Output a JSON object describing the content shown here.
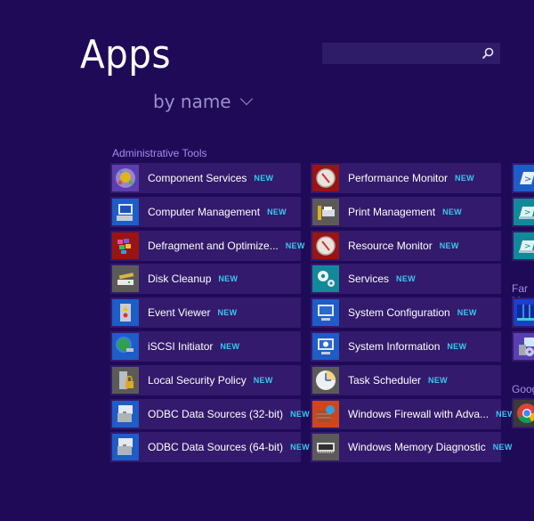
{
  "header": {
    "title": "Apps",
    "sort_label": "by name",
    "search": {
      "value": "",
      "placeholder": ""
    }
  },
  "colors": {
    "background": "#1e0a57",
    "tile": "#331a6c",
    "badge": "#39c8f0",
    "group_label": "#a58ce8"
  },
  "groups": [
    {
      "label": "Administrative Tools",
      "columns": [
        [
          {
            "label": "Component Services",
            "badge": "NEW",
            "icon": "component-services-icon",
            "icon_bg": "#5b3fb0"
          },
          {
            "label": "Computer Management",
            "badge": "NEW",
            "icon": "computer-management-icon",
            "icon_bg": "#1e5cc8"
          },
          {
            "label": "Defragment and Optimize...",
            "badge": "NEW",
            "icon": "defragment-icon",
            "icon_bg": "#9b1414"
          },
          {
            "label": "Disk Cleanup",
            "badge": "NEW",
            "icon": "disk-cleanup-icon",
            "icon_bg": "#5c5a58"
          },
          {
            "label": "Event Viewer",
            "badge": "NEW",
            "icon": "event-viewer-icon",
            "icon_bg": "#1e5cc8"
          },
          {
            "label": "iSCSI Initiator",
            "badge": "NEW",
            "icon": "iscsi-initiator-icon",
            "icon_bg": "#1e5cc8"
          },
          {
            "label": "Local Security Policy",
            "badge": "NEW",
            "icon": "local-security-policy-icon",
            "icon_bg": "#5c5a58"
          },
          {
            "label": "ODBC Data Sources (32-bit)",
            "badge": "NEW",
            "icon": "odbc-icon",
            "icon_bg": "#1e5cc8"
          },
          {
            "label": "ODBC Data Sources (64-bit)",
            "badge": "NEW",
            "icon": "odbc-icon",
            "icon_bg": "#1e5cc8"
          }
        ],
        [
          {
            "label": "Performance Monitor",
            "badge": "NEW",
            "icon": "performance-monitor-icon",
            "icon_bg": "#9b1414"
          },
          {
            "label": "Print Management",
            "badge": "NEW",
            "icon": "print-management-icon",
            "icon_bg": "#5c5a58"
          },
          {
            "label": "Resource Monitor",
            "badge": "NEW",
            "icon": "resource-monitor-icon",
            "icon_bg": "#9b1414"
          },
          {
            "label": "Services",
            "badge": "NEW",
            "icon": "services-icon",
            "icon_bg": "#12899a"
          },
          {
            "label": "System Configuration",
            "badge": "NEW",
            "icon": "system-configuration-icon",
            "icon_bg": "#1e5cc8"
          },
          {
            "label": "System Information",
            "badge": "NEW",
            "icon": "system-information-icon",
            "icon_bg": "#1e5cc8"
          },
          {
            "label": "Task Scheduler",
            "badge": "NEW",
            "icon": "task-scheduler-icon",
            "icon_bg": "#5c5a58"
          },
          {
            "label": "Windows Firewall with Adva...",
            "badge": "NEW",
            "icon": "windows-firewall-icon",
            "icon_bg": "#d0461c"
          },
          {
            "label": "Windows Memory Diagnostic",
            "badge": "NEW",
            "icon": "memory-diagnostic-icon",
            "icon_bg": "#5c5a58"
          }
        ],
        [
          {
            "label": "",
            "badge": "",
            "icon": "powershell-icon",
            "icon_bg": "#1e5cc8"
          },
          {
            "label": "",
            "badge": "",
            "icon": "powershell-ise-icon",
            "icon_bg": "#12899a"
          },
          {
            "label": "",
            "badge": "",
            "icon": "powershell-ise-icon",
            "icon_bg": "#12899a"
          }
        ]
      ]
    },
    {
      "label": "Far M",
      "items": [
        {
          "icon": "far-manager-icon",
          "icon_bg": "#1a3fd0"
        },
        {
          "icon": "installer-icon",
          "icon_bg": "#5b3fb0"
        }
      ]
    },
    {
      "label": "Goog",
      "items": [
        {
          "icon": "chrome-icon",
          "icon_bg": "#3a3a3a"
        }
      ]
    }
  ]
}
